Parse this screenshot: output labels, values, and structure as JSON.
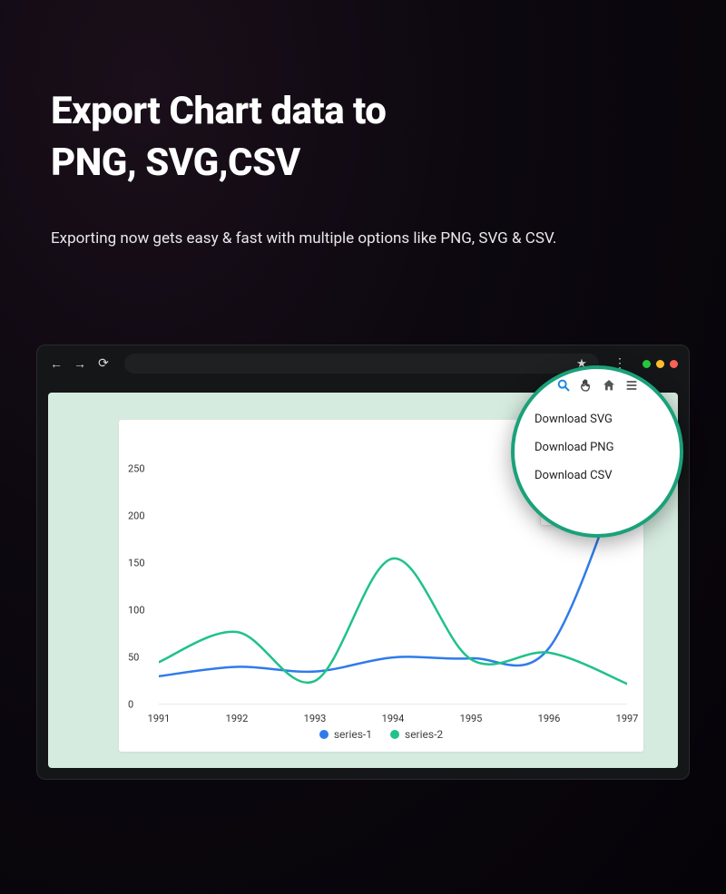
{
  "hero": {
    "title_l1": "Export Chart data to",
    "title_l2": "PNG, SVG,CSV",
    "subtitle": "Exporting now gets easy & fast with multiple options like PNG, SVG & CSV."
  },
  "menu": {
    "svg": "Download SVG",
    "png": "Download PNG",
    "csv": "Download CSV"
  },
  "toolbar": {
    "zoom_in": "+",
    "zoom_out": "−",
    "zoom": "search",
    "pan": "hand",
    "home": "home",
    "menu": "menu"
  },
  "legend": {
    "s1": "series-1",
    "s2": "series-2"
  },
  "chart_data": {
    "type": "line",
    "title": "",
    "xlabel": "",
    "ylabel": "",
    "x": [
      1991,
      1992,
      1993,
      1994,
      1995,
      1996,
      1997
    ],
    "ylim": [
      0,
      260
    ],
    "y_ticks": [
      0,
      50,
      100,
      150,
      200,
      250
    ],
    "x_ticks": [
      1991,
      1992,
      1993,
      1994,
      1995,
      1996,
      1997
    ],
    "series": [
      {
        "name": "series-1",
        "color": "#2f7bea",
        "values": [
          30,
          40,
          35,
          50,
          49,
          60,
          260
        ]
      },
      {
        "name": "series-2",
        "color": "#1fc28a",
        "values": [
          45,
          77,
          25,
          155,
          48,
          55,
          22
        ]
      }
    ]
  }
}
